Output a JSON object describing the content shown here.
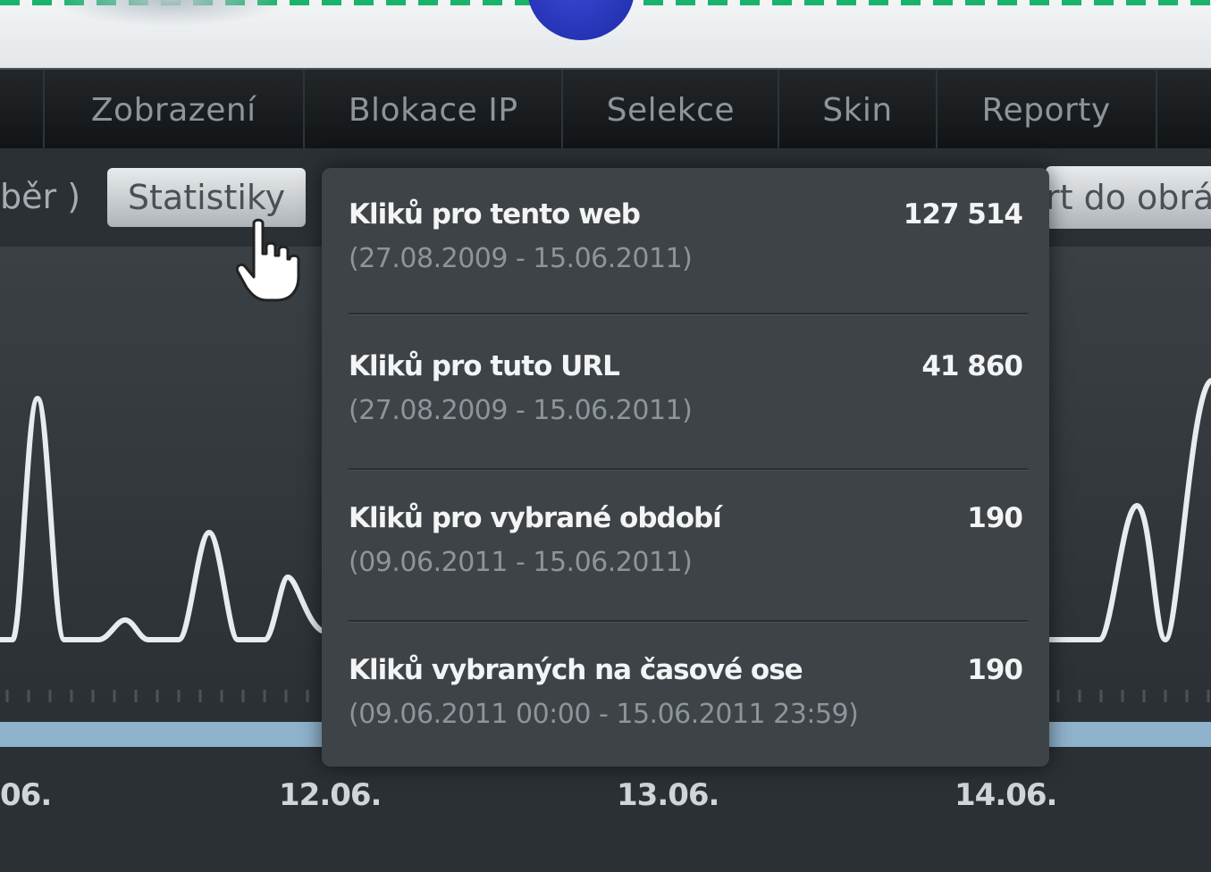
{
  "navbar": {
    "tabs": [
      {
        "label": "Zobrazení"
      },
      {
        "label": "Blokace IP"
      },
      {
        "label": "Selekce"
      },
      {
        "label": "Skin"
      },
      {
        "label": "Reporty"
      }
    ]
  },
  "toolbar": {
    "left_partial": "běr )",
    "statistics_button": "Statistiky",
    "export_partial": "rt do obrá"
  },
  "popup": {
    "rows": [
      {
        "label": "Kliků pro tento web",
        "range": "(27.08.2009 - 15.06.2011)",
        "value": "127 514"
      },
      {
        "label": "Kliků pro tuto URL",
        "range": "(27.08.2009 - 15.06.2011)",
        "value": "41 860"
      },
      {
        "label": "Kliků pro vybrané období",
        "range": "(09.06.2011 - 15.06.2011)",
        "value": "190"
      },
      {
        "label": "Kliků vybraných na časové ose",
        "range": "(09.06.2011 00:00 - 15.06.2011 23:59)",
        "value": "190"
      }
    ]
  },
  "timeline": {
    "dates": [
      "06.",
      "12.06.",
      "13.06.",
      "14.06."
    ]
  },
  "colors": {
    "accent_dash": "#19b36b",
    "line": "#e9ecee",
    "timeline_bar": "#8fb3cc"
  },
  "icons": [
    "hand-pointer-icon"
  ]
}
